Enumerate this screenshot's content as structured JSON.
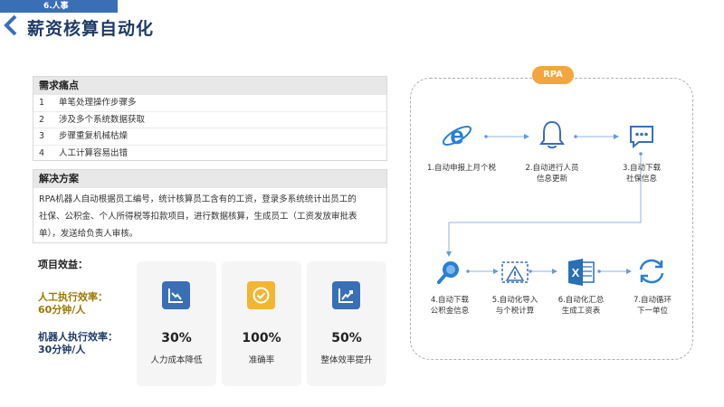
{
  "header": {
    "section_tag": "6.人事",
    "title": "薪资核算自动化"
  },
  "pain_points": {
    "title": "需求痛点",
    "items": [
      {
        "num": "1",
        "text": "单笔处理操作步骤多"
      },
      {
        "num": "2",
        "text": "涉及多个系统数据获取"
      },
      {
        "num": "3",
        "text": "步骤重复机械枯燥"
      },
      {
        "num": "4",
        "text": "人工计算容易出错"
      }
    ]
  },
  "solution": {
    "title": "解决方案",
    "lines": [
      "RPA机器人自动根据员工编号，统计核算员工含有的工资，登录多系统统计出员工的",
      "社保、公积金、个人所得税等扣款项目，进行数据核算，生成员工（工资发放审批表",
      "单），发送给负责人审核。"
    ]
  },
  "effects": {
    "title": "项目效益：",
    "manual_label": "人工执行效率：",
    "manual_value": "60分钟/人",
    "robot_label": "机器人执行效率：",
    "robot_value": "30分钟/人",
    "cards": [
      {
        "value": "30%",
        "label": "人力成本降低",
        "icon": "chart-down-icon",
        "color": "#3a6fb6"
      },
      {
        "value": "100%",
        "label": "准确率",
        "icon": "check-circle-icon",
        "color": "#f2b632"
      },
      {
        "value": "50%",
        "label": "整体效率提升",
        "icon": "chart-up-icon",
        "color": "#3a6fb6"
      }
    ]
  },
  "rpa": {
    "badge": "RPA",
    "steps": [
      {
        "line1": "1.自动申报上月个税",
        "line2": "",
        "icon": "ie-browser-icon"
      },
      {
        "line1": "2.自动进行人员",
        "line2": "信息更新",
        "icon": "bell-icon"
      },
      {
        "line1": "3.自动下载",
        "line2": "社保信息",
        "icon": "chat-icon"
      },
      {
        "line1": "4.自动下载",
        "line2": "公积金信息",
        "icon": "search-icon"
      },
      {
        "line1": "5.自动化导入",
        "line2": "与个税计算",
        "icon": "warning-chart-icon"
      },
      {
        "line1": "6.自动化汇总",
        "line2": "生成工资表",
        "icon": "excel-icon"
      },
      {
        "line1": "7.自动循环",
        "line2": "下一单位",
        "icon": "refresh-icon"
      }
    ]
  }
}
